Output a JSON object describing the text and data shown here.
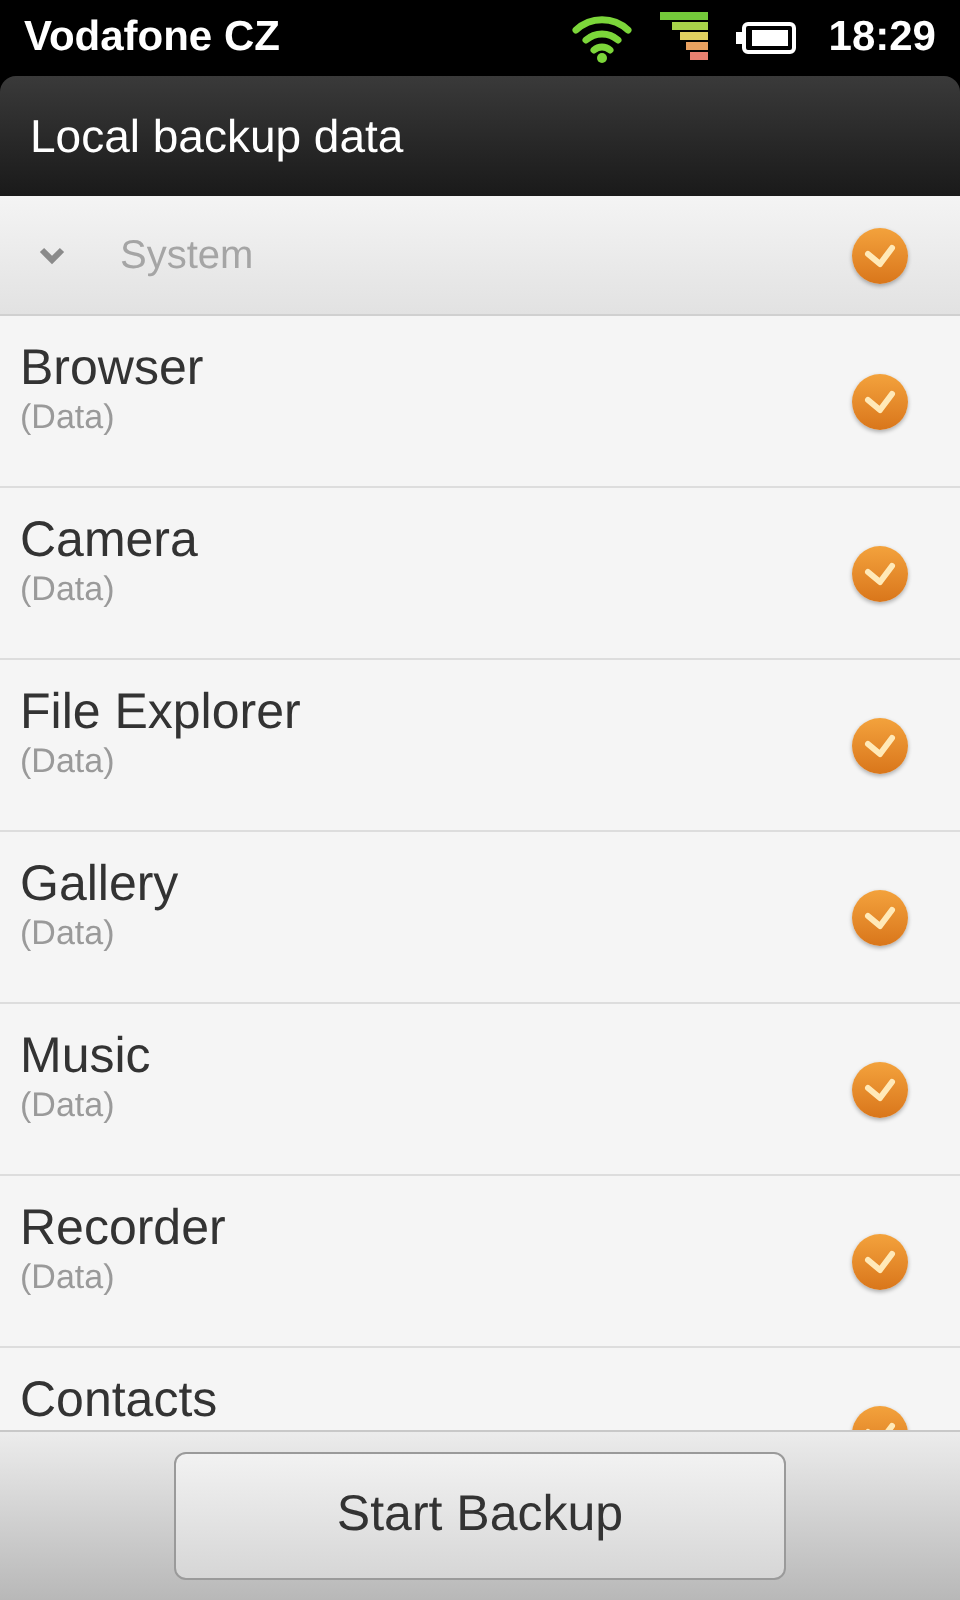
{
  "status_bar": {
    "carrier": "Vodafone CZ",
    "time": "18:29"
  },
  "title": "Local backup data",
  "group": {
    "label": "System",
    "expanded": true,
    "checked": true
  },
  "items": [
    {
      "name": "Browser",
      "detail": "(Data)",
      "checked": true
    },
    {
      "name": "Camera",
      "detail": "(Data)",
      "checked": true
    },
    {
      "name": "File Explorer",
      "detail": "(Data)",
      "checked": true
    },
    {
      "name": "Gallery",
      "detail": "(Data)",
      "checked": true
    },
    {
      "name": "Music",
      "detail": "(Data)",
      "checked": true
    },
    {
      "name": "Recorder",
      "detail": "(Data)",
      "checked": true
    },
    {
      "name": "Contacts",
      "checked": true
    }
  ],
  "button": "Start Backup"
}
